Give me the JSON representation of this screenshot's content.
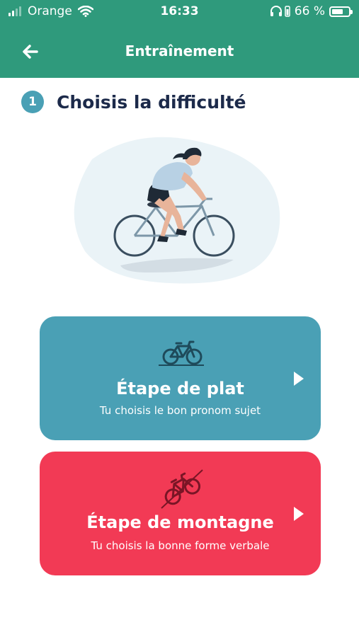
{
  "status_bar": {
    "carrier": "Orange",
    "time": "16:33",
    "battery_percent": "66 %",
    "battery_level": 0.66
  },
  "nav": {
    "title": "Entraînement"
  },
  "step": {
    "number": "1",
    "title": "Choisis la difficulté"
  },
  "options": [
    {
      "title": "Étape de plat",
      "subtitle": "Tu choisis le bon pronom sujet",
      "color": "#4aa0b5",
      "icon": "bicycle-flat-icon"
    },
    {
      "title": "Étape de montagne",
      "subtitle": "Tu choisis la bonne forme verbale",
      "color": "#f23a55",
      "icon": "bicycle-uphill-icon"
    }
  ],
  "colors": {
    "header": "#2f9a7c",
    "title_text": "#1c2a4a"
  }
}
